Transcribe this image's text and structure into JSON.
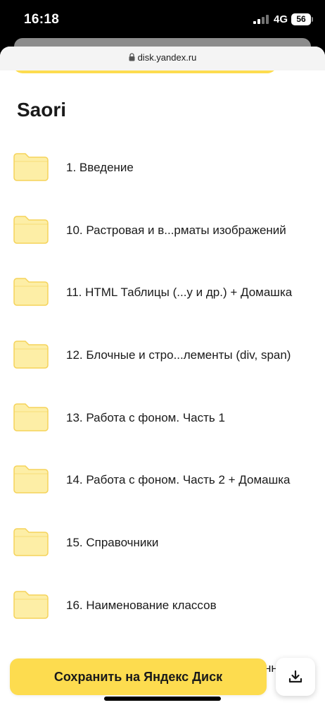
{
  "status_bar": {
    "time": "16:18",
    "network": "4G",
    "battery": "56"
  },
  "browser": {
    "url": "disk.yandex.ru"
  },
  "folder": {
    "title": "Saori"
  },
  "files": [
    {
      "name": "1. Введение",
      "icon": "folder-icon"
    },
    {
      "name": "10. Растровая и в...рматы изображений",
      "icon": "folder-icon"
    },
    {
      "name": "11. HTML Таблицы (...у и др.) + Домашка",
      "icon": "folder-icon"
    },
    {
      "name": "12. Блочные и стро...лементы (div, span)",
      "icon": "folder-icon"
    },
    {
      "name": "13. Работа с фоном. Часть 1",
      "icon": "folder-icon"
    },
    {
      "name": "14. Работа с фоном. Часть 2 + Домашка",
      "icon": "folder-icon"
    },
    {
      "name": "15. Справочники",
      "icon": "folder-icon"
    },
    {
      "name": "16. Наименование классов",
      "icon": "folder-icon"
    }
  ],
  "actions": {
    "save_label": "Сохранить на Яндекс Диск",
    "download_icon": "download-icon"
  },
  "colors": {
    "accent": "#fddc4f",
    "folder_fill": "#fdeea6",
    "folder_stroke": "#f5d35a"
  }
}
